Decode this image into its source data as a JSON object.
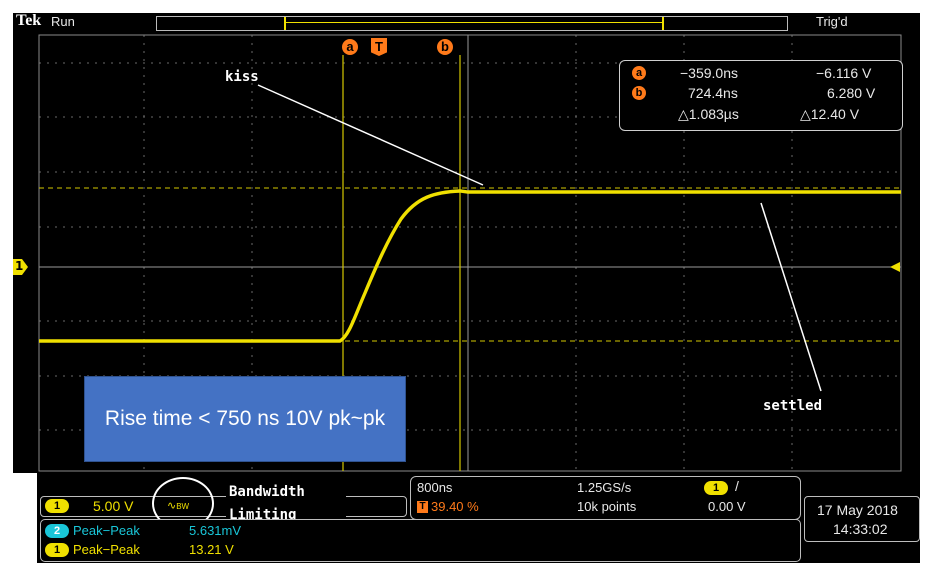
{
  "header": {
    "brand": "Tek",
    "run_state": "Run",
    "trigger_state": "Trig'd"
  },
  "cursors": {
    "a_label": "a",
    "b_label": "b",
    "t_label": "T",
    "a_time": "−359.0ns",
    "a_volt": "−6.116 V",
    "b_time": "724.4ns",
    "b_volt": "6.280 V",
    "delta_time": "△1.083µs",
    "delta_volt": "△12.40 V"
  },
  "channel_marker": "1",
  "annotations": {
    "kiss": "kiss",
    "settled": "settled",
    "bandwidth_line1": "Bandwidth",
    "bandwidth_line2": "Limiting",
    "callout": "Rise time < 750 ns 10V pk~pk"
  },
  "channel_settings": {
    "channel": "1",
    "volts_per_div": "5.00 V",
    "bw_symbol": "BW"
  },
  "timebase": {
    "time_per_div": "800ns",
    "sample_rate": "1.25GS/s",
    "trigger_channel": "1",
    "trigger_slope": "/",
    "trigger_position_label": "T",
    "trigger_position": "39.40 %",
    "record_length": "10k points",
    "trigger_level": "0.00 V"
  },
  "datetime": {
    "date": "17 May 2018",
    "time": "14:33:02"
  },
  "measurements": [
    {
      "channel": "2",
      "name": "Peak−Peak",
      "value": "5.631mV",
      "color": "#19c6d8"
    },
    {
      "channel": "1",
      "name": "Peak−Peak",
      "value": "13.21 V",
      "color": "#f0e000"
    }
  ],
  "colors": {
    "ch1": "#f0e000",
    "ch2": "#19c6d8",
    "cursor": "#ff7a1a",
    "callout_fill": "#4472c4"
  }
}
